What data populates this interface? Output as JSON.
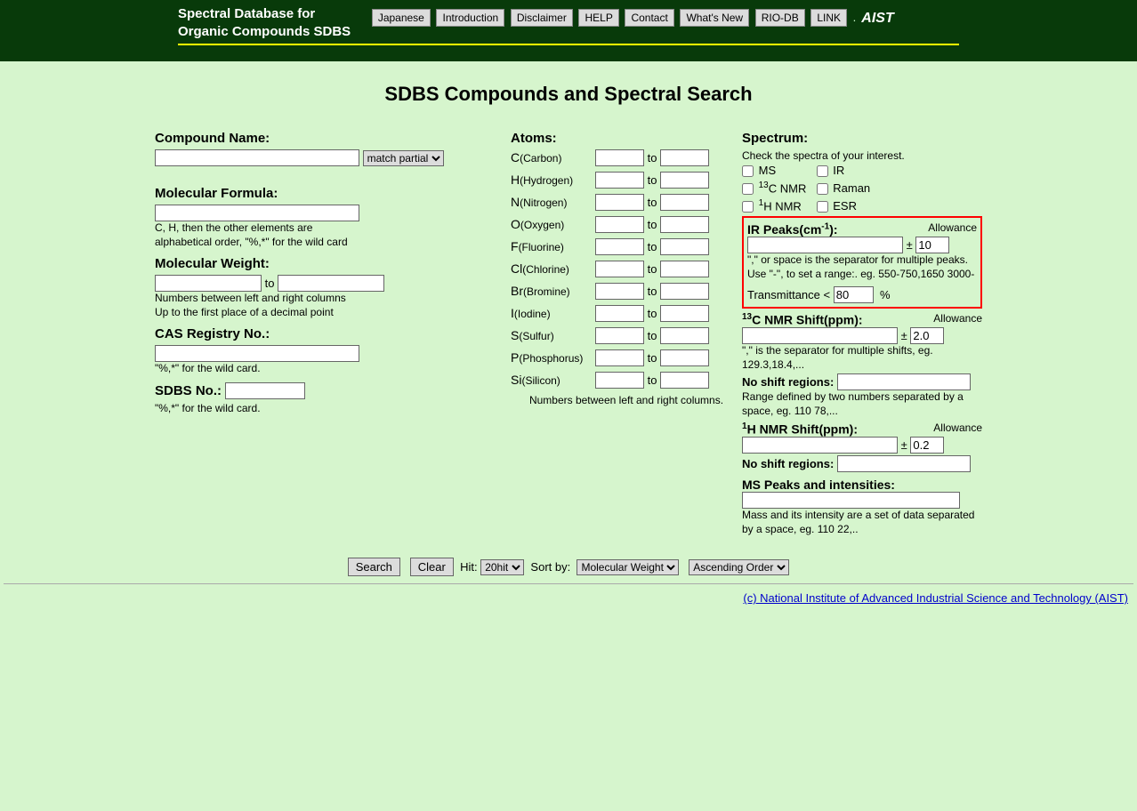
{
  "header": {
    "title_line1": "Spectral Database for",
    "title_line2": "Organic Compounds SDBS",
    "nav": [
      "Japanese",
      "Introduction",
      "Disclaimer",
      "HELP",
      "Contact",
      "What's New",
      "RIO-DB",
      "LINK"
    ],
    "logo": "AIST"
  },
  "page_title": "SDBS Compounds and Spectral Search",
  "compound": {
    "label": "Compound Name:",
    "match_select": "match partial"
  },
  "formula": {
    "label": "Molecular Formula:",
    "hint1": "C, H, then the other elements are",
    "hint2": "alphabetical order, \"%,*\" for the wild card"
  },
  "mw": {
    "label": "Molecular Weight:",
    "to": "to",
    "hint1": "Numbers between left and right columns",
    "hint2": "Up to the first place of a decimal point"
  },
  "cas": {
    "label": "CAS Registry No.:",
    "hint": "\"%,*\" for the wild card."
  },
  "sdbs": {
    "label": "SDBS No.:",
    "hint": "\"%,*\" for the wild card."
  },
  "atoms": {
    "label": "Atoms:",
    "to": "to",
    "items": [
      {
        "sym": "C",
        "name": "Carbon"
      },
      {
        "sym": "H",
        "name": "Hydrogen"
      },
      {
        "sym": "N",
        "name": "Nitrogen"
      },
      {
        "sym": "O",
        "name": "Oxygen"
      },
      {
        "sym": "F",
        "name": "Fluorine"
      },
      {
        "sym": "Cl",
        "name": "Chlorine"
      },
      {
        "sym": "Br",
        "name": "Bromine"
      },
      {
        "sym": "I",
        "name": "Iodine"
      },
      {
        "sym": "S",
        "name": "Sulfur"
      },
      {
        "sym": "P",
        "name": "Phosphorus"
      },
      {
        "sym": "Si",
        "name": "Silicon"
      }
    ],
    "hint": "Numbers between left and right columns."
  },
  "spectrum": {
    "label": "Spectrum:",
    "hint": "Check the spectra of your interest.",
    "ms": "MS",
    "ir": "IR",
    "cnmr_pre": "13",
    "cnmr": "C NMR",
    "raman": "Raman",
    "hnmr_pre": "1",
    "hnmr": "H NMR",
    "esr": "ESR"
  },
  "ir": {
    "label_pre": "IR Peaks(cm",
    "label_sup": "-1",
    "label_post": "):",
    "allowance_label": "Allowance",
    "plus_minus": "±",
    "allowance_val": "10",
    "hint1": "\",\" or space is the separator for multiple peaks.",
    "hint2": "Use \"-\", to set a range:. eg. 550-750,1650 3000-",
    "trans_label": "Transmittance <",
    "trans_val": "80",
    "percent": "%"
  },
  "cnmr_shift": {
    "label_pre": "13",
    "label": "C NMR Shift(ppm):",
    "allowance_label": "Allowance",
    "plus_minus": "±",
    "allowance_val": "2.0",
    "hint": "\",\" is the separator for multiple shifts, eg. 129.3,18.4,...",
    "noshift_label": "No shift regions:",
    "noshift_hint": "Range defined by two numbers separated by a space, eg. 110 78,..."
  },
  "hnmr_shift": {
    "label_pre": "1",
    "label": "H NMR Shift(ppm):",
    "allowance_label": "Allowance",
    "plus_minus": "±",
    "allowance_val": "0.2",
    "noshift_label": "No shift regions:"
  },
  "ms_peaks": {
    "label": "MS Peaks and intensities:",
    "hint": "Mass and its intensity are a set of data separated by a space, eg. 110 22,.."
  },
  "footer": {
    "search": "Search",
    "clear": "Clear",
    "hit_label": "Hit:",
    "hit_val": "20hit",
    "sort_label": "Sort by:",
    "sort_val": "Molecular Weight",
    "order_val": "Ascending Order"
  },
  "copyright": "(c) National Institute of Advanced Industrial Science and Technology (AIST)"
}
